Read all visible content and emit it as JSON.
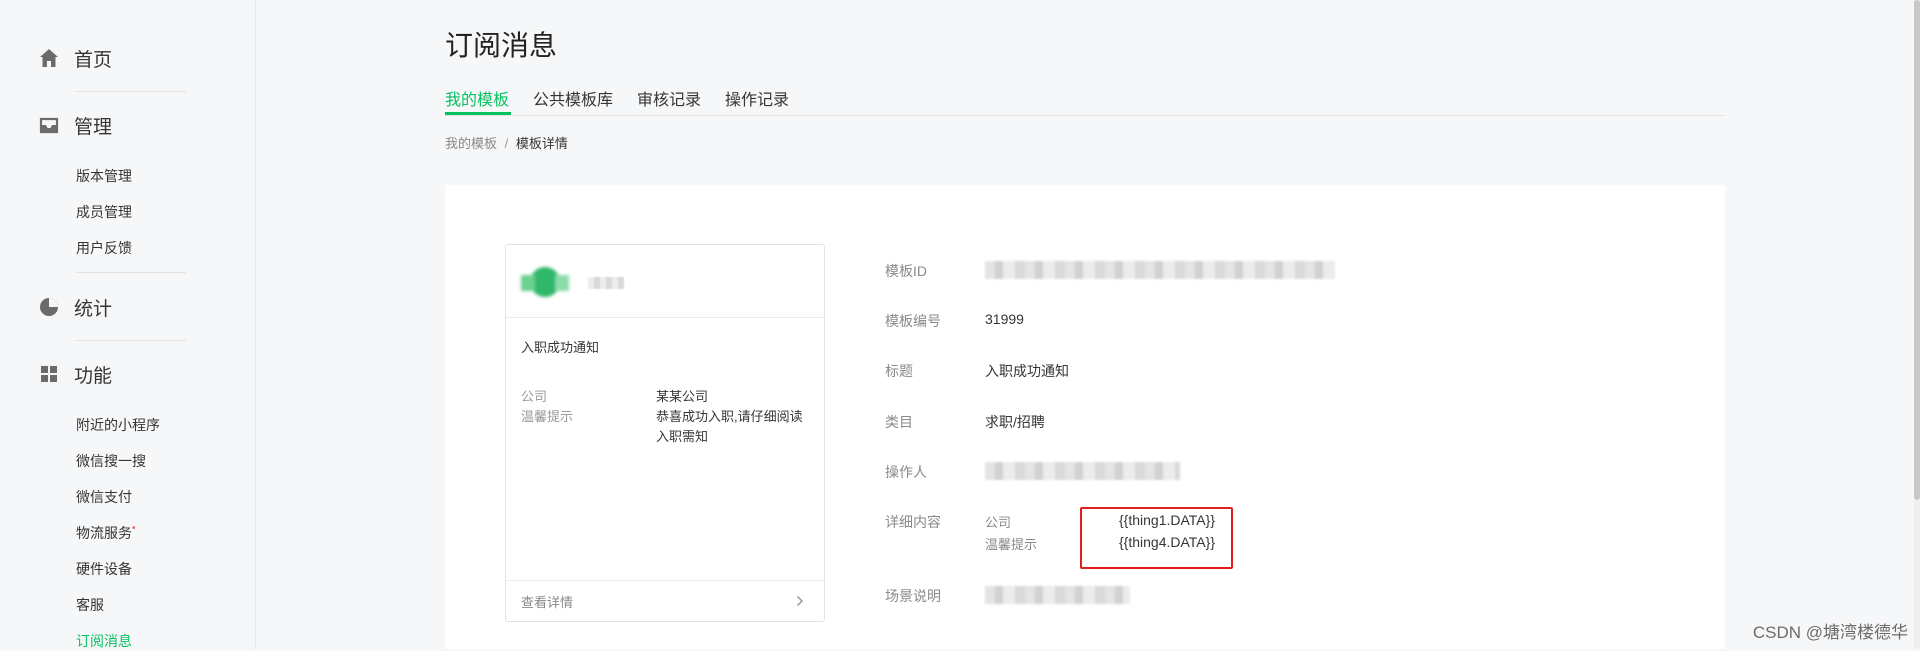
{
  "sidebar": {
    "home": {
      "label": "首页"
    },
    "manage": {
      "label": "管理",
      "items": [
        "版本管理",
        "成员管理",
        "用户反馈"
      ]
    },
    "stats": {
      "label": "统计"
    },
    "features": {
      "label": "功能",
      "items": [
        "附近的小程序",
        "微信搜一搜",
        "微信支付",
        "物流服务",
        "硬件设备",
        "客服",
        "订阅消息"
      ]
    },
    "new_dot": "•"
  },
  "page_title": "订阅消息",
  "tabs": [
    "我的模板",
    "公共模板库",
    "审核记录",
    "操作记录"
  ],
  "breadcrumb": {
    "root": "我的模板",
    "sep": "/",
    "current": "模板详情"
  },
  "preview": {
    "title": "入职成功通知",
    "fields": [
      {
        "key": "公司",
        "value": "某某公司"
      },
      {
        "key": "温馨提示",
        "value": "恭喜成功入职,请仔细阅读入职需知"
      }
    ],
    "more": "查看详情"
  },
  "detail": {
    "template_id_label": "模板ID",
    "number_label": "模板编号",
    "number_value": "31999",
    "title_label": "标题",
    "title_value": "入职成功通知",
    "category_label": "类目",
    "category_value": "求职/招聘",
    "operator_label": "操作人",
    "content_label": "详细内容",
    "content": [
      {
        "key": "公司",
        "value": "{{thing1.DATA}}"
      },
      {
        "key": "温馨提示",
        "value": "{{thing4.DATA}}"
      }
    ],
    "scene_label": "场景说明"
  },
  "watermark": "CSDN @塘湾楼德华",
  "colors": {
    "accent": "#07c160",
    "highlight_box": "#e02020",
    "background": "#f6f7f9"
  }
}
